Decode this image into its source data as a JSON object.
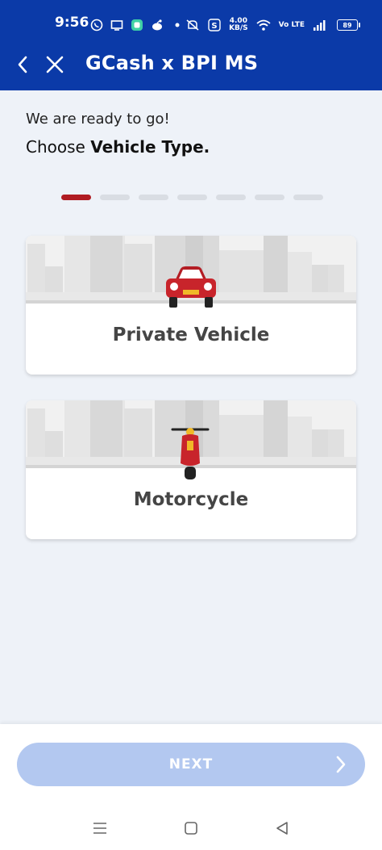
{
  "status_bar": {
    "time": "9:56",
    "speed_value": "4.00",
    "speed_unit": "KB/S",
    "volte": "Vo LTE",
    "battery": "89",
    "icons": [
      "viber-icon",
      "screen-icon",
      "messenger-icon",
      "reddit-icon",
      "dot-icon",
      "mute-icon",
      "s-icon",
      "wifi-icon",
      "signal-icon"
    ]
  },
  "header": {
    "title": "GCash x BPI MS",
    "back_icon": "chevron-left-icon",
    "close_icon": "close-icon"
  },
  "content": {
    "greeting": "We are ready to go!",
    "prompt_prefix": "Choose ",
    "prompt_bold": "Vehicle Type.",
    "steps_total": 7,
    "active_step": 1
  },
  "options": [
    {
      "label": "Private Vehicle",
      "icon": "car-icon"
    },
    {
      "label": "Motorcycle",
      "icon": "scooter-icon"
    }
  ],
  "footer": {
    "next_label": "NEXT",
    "next_icon": "chevron-right-icon"
  },
  "colors": {
    "brand": "#0b3aa8",
    "accent": "#b01c22",
    "button_disabled": "#b3c8f0",
    "background": "#eef2f8"
  }
}
